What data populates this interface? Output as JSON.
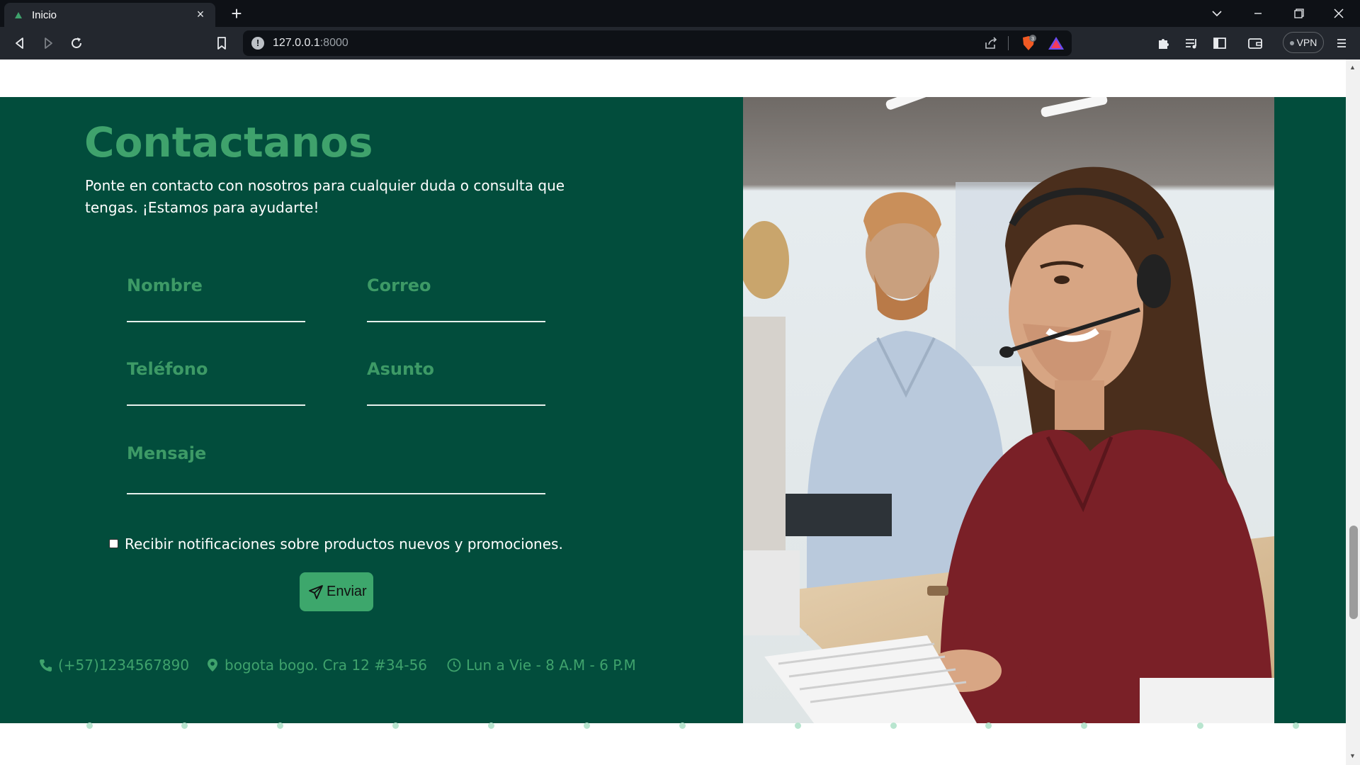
{
  "browser": {
    "tab_title": "Inicio",
    "tab_close": "×",
    "new_tab": "+",
    "url_host": "127.0.0.1",
    "url_port": ":8000",
    "vpn_label": "VPN",
    "shield_count": "3",
    "icons": [
      "back-icon",
      "forward-icon",
      "reload-icon",
      "bookmark-icon",
      "share-icon",
      "brave-shield-icon",
      "brave-rewards-icon",
      "extensions-icon",
      "playlist-icon",
      "sidebar-icon",
      "wallet-icon",
      "menu-icon"
    ]
  },
  "contact": {
    "title": "Contactanos",
    "description": "Ponte en contacto con nosotros para cualquier duda o consulta que tengas. ¡Estamos para ayudarte!",
    "fields": {
      "name": "Nombre",
      "email": "Correo",
      "phone": "Teléfono",
      "subject": "Asunto",
      "message": "Mensaje"
    },
    "notify_label": "Recibir notificaciones sobre productos nuevos y promociones.",
    "send_label": "Enviar",
    "info": {
      "phone": "(+57)1234567890",
      "address": "bogota bogo. Cra 12 #34-56",
      "hours": "Lun a Vie - 8 A.M - 6 P.M"
    }
  },
  "colors": {
    "section_bg": "#024d3c",
    "accent": "#3fa26c",
    "button": "#3da76c"
  }
}
